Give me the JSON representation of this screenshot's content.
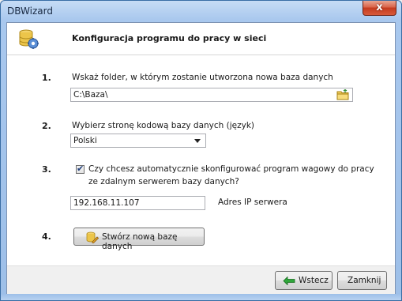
{
  "window": {
    "title": "DBWizard",
    "close_glyph": "x"
  },
  "header": {
    "title": "Konfiguracja programu do pracy w sieci",
    "icon": "database-settings-icon"
  },
  "steps": [
    {
      "number": "1.",
      "label": "Wskaż folder, w którym zostanie utworzona nowa baza danych",
      "value": "C:\\Baza\\"
    },
    {
      "number": "2.",
      "label": "Wybierz stronę kodową bazy danych  (język)",
      "value": "Polski"
    },
    {
      "number": "3.",
      "label_line1": "Czy chcesz automatycznie skonfigurować program wagowy do pracy",
      "label_line2": "ze zdalnym serwerem bazy danych?",
      "checked": true,
      "ip_value": "192.168.11.107",
      "ip_label": "Adres IP serwera"
    },
    {
      "number": "4.",
      "button_label": "Stwórz nową bazę danych"
    }
  ],
  "footer": {
    "back_label": "Wstecz",
    "close_label": "Zamknij"
  },
  "colors": {
    "accent": "#3a6ea5",
    "back_arrow": "#1e8a2a"
  }
}
